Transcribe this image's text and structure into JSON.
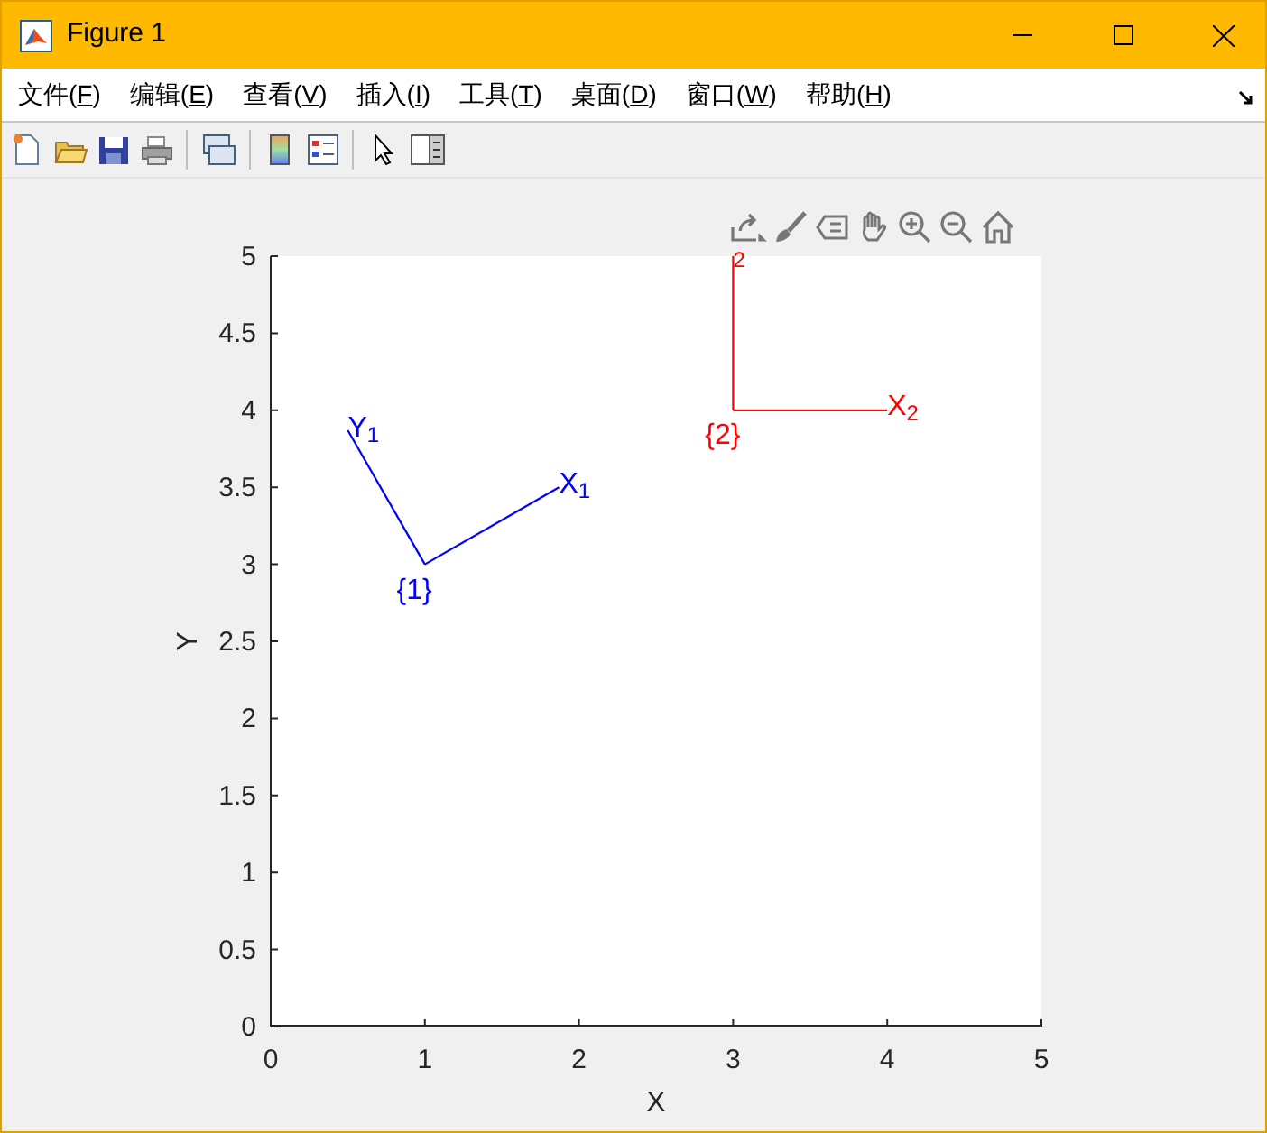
{
  "window": {
    "title": "Figure 1"
  },
  "menu": [
    {
      "before": "文件(",
      "key": "F",
      "after": ")"
    },
    {
      "before": "编辑(",
      "key": "E",
      "after": ")"
    },
    {
      "before": "查看(",
      "key": "V",
      "after": ")"
    },
    {
      "before": "插入(",
      "key": "I",
      "after": ")"
    },
    {
      "before": "工具(",
      "key": "T",
      "after": ")"
    },
    {
      "before": "桌面(",
      "key": "D",
      "after": ")"
    },
    {
      "before": "窗口(",
      "key": "W",
      "after": ")"
    },
    {
      "before": "帮助(",
      "key": "H",
      "after": ")"
    }
  ],
  "plot": {
    "chart_data": {
      "type": "line",
      "xlabel": "X",
      "ylabel": "Y",
      "xlim": [
        0,
        5
      ],
      "ylim": [
        0,
        5
      ],
      "xticks": [
        0,
        1,
        2,
        3,
        4,
        5
      ],
      "yticks": [
        0,
        {
          "value": 0.5,
          "label": "0.5"
        },
        1,
        {
          "value": 1.5,
          "label": "1.5"
        },
        2,
        {
          "value": 2.5,
          "label": "2.5"
        },
        3,
        {
          "value": 3.5,
          "label": "3.5"
        },
        4,
        {
          "value": 4.5,
          "label": "4.5"
        },
        5
      ],
      "series": [
        {
          "color": "#0000ff",
          "x": [
            1,
            1.87
          ],
          "values": [
            3,
            3.5
          ]
        },
        {
          "color": "#0000ff",
          "x": [
            1,
            0.5
          ],
          "values": [
            3,
            3.87
          ]
        },
        {
          "color": "#ff0000",
          "x": [
            3,
            4
          ],
          "values": [
            4,
            4
          ]
        },
        {
          "color": "#ff0000",
          "x": [
            3,
            3
          ],
          "values": [
            4,
            5
          ]
        }
      ],
      "annotations": [
        {
          "text": "X$_{1}$",
          "x": 1.87,
          "y": 3.5
        },
        {
          "text": "Y$_{1}$",
          "x": 0.5,
          "y": 3.87
        },
        {
          "text": "{1}",
          "x": 1,
          "y": 3
        },
        {
          "text": "X$_{2}$",
          "x": 4,
          "y": 4
        },
        {
          "text": "$_{2}$",
          "x": 3,
          "y": 5
        },
        {
          "text": "{2}",
          "x": 3,
          "y": 4
        }
      ]
    }
  }
}
